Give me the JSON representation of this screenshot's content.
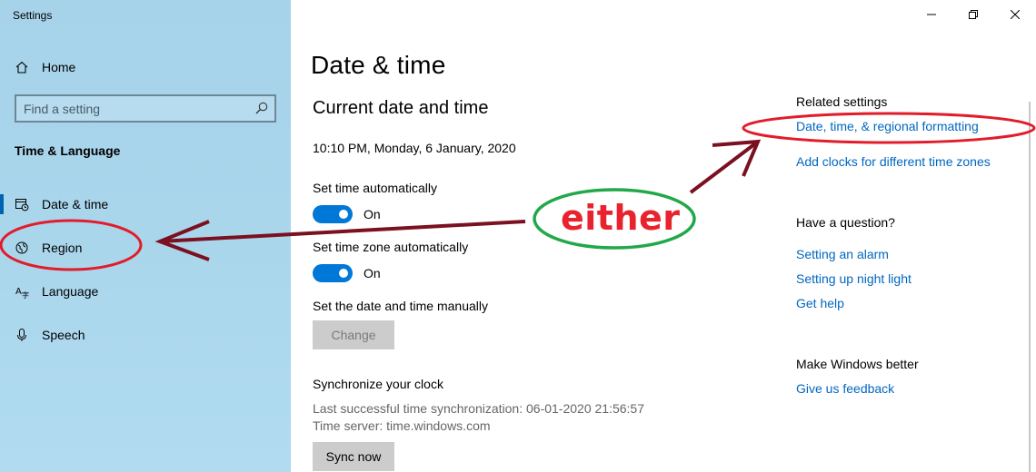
{
  "window": {
    "title": "Settings"
  },
  "sidebar": {
    "home_label": "Home",
    "search_placeholder": "Find a setting",
    "section_title": "Time & Language",
    "items": [
      {
        "label": "Date & time",
        "icon": "calendar-clock-icon",
        "active": true
      },
      {
        "label": "Region",
        "icon": "globe-icon",
        "active": false
      },
      {
        "label": "Language",
        "icon": "language-icon",
        "active": false
      },
      {
        "label": "Speech",
        "icon": "microphone-icon",
        "active": false
      }
    ]
  },
  "main": {
    "title": "Date & time",
    "subtitle": "Current date and time",
    "current_datetime": "10:10 PM, Monday, 6 January, 2020",
    "set_time_auto": {
      "label": "Set time automatically",
      "state": "On"
    },
    "set_zone_auto": {
      "label": "Set time zone automatically",
      "state": "On"
    },
    "manual": {
      "label": "Set the date and time manually",
      "button": "Change"
    },
    "sync": {
      "title": "Synchronize your clock",
      "last_sync": "Last successful time synchronization: 06-01-2020 21:56:57",
      "server": "Time server: time.windows.com",
      "button": "Sync now"
    }
  },
  "related": {
    "heading": "Related settings",
    "links": [
      "Date, time, & regional formatting",
      "Add clocks for different time zones"
    ],
    "question_heading": "Have a question?",
    "help_links": [
      "Setting an alarm",
      "Setting up night light",
      "Get help"
    ],
    "better_heading": "Make Windows better",
    "feedback_link": "Give us feedback"
  },
  "annotation": {
    "label": "either",
    "label_color": "#e8232e",
    "circle_green": "#22a84a",
    "circle_red": "#e21c2a",
    "arrow_color": "#7a1020"
  },
  "colors": {
    "accent": "#0078d7",
    "link": "#0067c0",
    "sidebar_bg": "#a9d5eb"
  }
}
